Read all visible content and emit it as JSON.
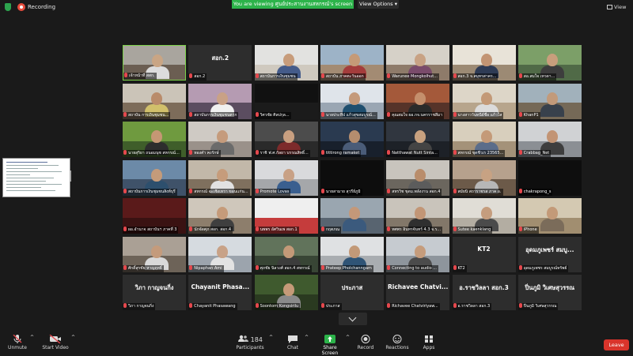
{
  "topbar": {
    "recording_label": "Recording",
    "viewing_banner": "You are viewing ศูนย์ประสานงานสหกรณ์'s screen",
    "view_options": "View Options",
    "view_button": "View"
  },
  "participants": [
    {
      "name": "เจ้าหน้าที่ สสก.",
      "big": "",
      "active": true,
      "bg": "#a9a59e",
      "bg2": "#6b5e52",
      "skin": "#c9a584",
      "shirt": "#dcdcdc"
    },
    {
      "name": "สอก.2",
      "big": "สอก.2",
      "bg": "",
      "bg2": ""
    },
    {
      "name": "สถาบันการเงินชุมชน",
      "big": "",
      "bg": "#e2e2e0",
      "bg2": "#cfc9bf",
      "skin": "#c79c7b",
      "shirt": "#445b8a"
    },
    {
      "name": "สถาบัน ภาคตะวันออก",
      "big": "",
      "bg": "#9db3c7",
      "bg2": "#a38b73",
      "skin": "#c59a77",
      "shirt": "#a43c3c"
    },
    {
      "name": "Warunee Mongkolhut...",
      "big": "",
      "bg": "#d6d1c8",
      "bg2": "#8e7b6a",
      "skin": "#c8a284",
      "shirt": "#7a4b6b"
    },
    {
      "name": "สอก.3 จ.สมุทรสาคร...",
      "big": "",
      "bg": "#e8e3d8",
      "bg2": "#9c8a74",
      "skin": "#c29473",
      "shirt": "#2e3b55"
    },
    {
      "name": "สอ.สมใจ เทวดา...",
      "big": "",
      "bg": "#7c9f68",
      "bg2": "#506a47",
      "skin": "#c89e7c",
      "shirt": "#3d3d3d"
    },
    {
      "name": "สถาบัน การเงินชุมชน...",
      "big": "",
      "bg": "#cbc4b8",
      "bg2": "#7d6c5a",
      "skin": "#b98b6a",
      "shirt": "#d1c06b"
    },
    {
      "name": "สถาบันการเงินชุมชนตาก",
      "big": "",
      "bg": "#b59bb2",
      "bg2": "#5b4d60",
      "skin": "#c9a186",
      "shirt": "#f0f0f0"
    },
    {
      "name": "วิศวชัย ศิลปกุล...",
      "big": "",
      "bg": "#111111",
      "bg2": "#1b1b1b",
      "skin": "",
      "shirt": ""
    },
    {
      "name": "นายประทีป แก้วสุขสมบูรณ์...",
      "big": "",
      "bg": "#dfe4ea",
      "bg2": "#9aa6b3",
      "skin": "#c49a7b",
      "shirt": "#1f4f6f"
    },
    {
      "name": "คุณสมใจ ผอ.กจ.นครราชสีมา",
      "big": "",
      "bg": "#a4593a",
      "bg2": "#563329",
      "skin": "#c48f6c",
      "shirt": "#2a2a2a"
    },
    {
      "name": "นางสาววันทนีย์ชื่อ แก้วใส",
      "big": "",
      "bg": "#ddd6c8",
      "bg2": "#b7a58c",
      "skin": "#c39977",
      "shirt": "#dbdbdb"
    },
    {
      "name": "KhanP1",
      "big": "",
      "bg": "#a1b1bb",
      "bg2": "#756957",
      "skin": "#c29a7a",
      "shirt": "#38414c"
    },
    {
      "name": "นายสุริยา ถนอมนุช สหกรณ์...",
      "big": "",
      "bg": "#6f9a3f",
      "bg2": "#3f5e2a",
      "skin": "#c59774",
      "shirt": "#2d2d2d"
    },
    {
      "name": "ทองคำ คงรักษ์",
      "big": "",
      "bg": "#cfcac4",
      "bg2": "#9a918a",
      "skin": "#c59b7c",
      "shirt": "#6b6b6b"
    },
    {
      "name": "ราชิ ฟ.ศ.กัลยา บรรณสิทธิ์...",
      "big": "",
      "bg": "#4c4c4c",
      "bg2": "#2a2a2a",
      "skin": "#c89f80",
      "shirt": "#7d2b2b"
    },
    {
      "name": "tittirong ramaket",
      "big": "",
      "bg": "#2a3a50",
      "bg2": "#18202c",
      "skin": "#b58d6e",
      "shirt": "#4a5c78"
    },
    {
      "name": "Natthawat Nutt Sinta...",
      "big": "",
      "bg": "#30363f",
      "bg2": "#1d2127",
      "skin": "#c8a17f",
      "shirt": "#444"
    },
    {
      "name": "สหกรณ์ ขุดชีวเร 23565...",
      "big": "",
      "bg": "#d8cfbd",
      "bg2": "#a49279",
      "skin": "#c49a78",
      "shirt": "#5b6d8a"
    },
    {
      "name": "Crabbag_Net",
      "big": "",
      "bg": "#d0d2d4",
      "bg2": "#8b8f94",
      "skin": "#c29474",
      "shirt": "#3e3e3e"
    },
    {
      "name": "สถาบันการเงินชุมชนสิงห์บุรี",
      "big": "",
      "bg": "#6c8aa8",
      "bg2": "#3f5269",
      "skin": "#c49b7a",
      "shirt": "#2d4f6d"
    },
    {
      "name": "สหกรณ์ ฉะเชิงเทรา ขอนแก่น...",
      "big": "",
      "bg": "#c2b8a9",
      "bg2": "#7f705e",
      "skin": "#c69c7b",
      "shirt": "#e2e2e2"
    },
    {
      "name": "Promote Lovas",
      "big": "",
      "bg": "#d9dadc",
      "bg2": "#a5a7aa",
      "skin": "#c8a185",
      "shirt": "#3a5f8f"
    },
    {
      "name": "นายสามาย สุวรีย์ภูมิ",
      "big": "",
      "bg": "#0d0d0d",
      "bg2": "#0d0d0d",
      "skin": "",
      "shirt": ""
    },
    {
      "name": "สหรวิช ขุดม.พลังงาน สอก.4",
      "big": "",
      "bg": "#c8c4bd",
      "bg2": "#6b665e",
      "skin": "#b98d6b",
      "shirt": "#5c5c5c"
    },
    {
      "name": "สมัยนิ สถาราชรส ภาค อ.",
      "big": "",
      "bg": "#b6a18d",
      "bg2": "#6c5a49",
      "skin": "#c7a283",
      "shirt": "#b7b7b7"
    },
    {
      "name": "chakrapong_s",
      "big": "",
      "bg": "#0e0e0e",
      "bg2": "#0e0e0e",
      "skin": "",
      "shirt": ""
    },
    {
      "name": "ผอ.อำนาจ สถาบันฯ ภาคที่ 3",
      "big": "",
      "bg": "#5a1a1a",
      "bg2": "#3a1212",
      "skin": "",
      "shirt": ""
    },
    {
      "name": "นักจัดศุภ สอก. สอก.4",
      "big": "",
      "bg": "#cfc7bb",
      "bg2": "#8d7e6c",
      "skin": "#c59b7a",
      "shirt": "#3f3f3f"
    },
    {
      "name": "นพพร อัศวินเพ สอก.1",
      "big": "",
      "bg": "#efefef",
      "bg2": "#c53c3c",
      "skin": "",
      "shirt": ""
    },
    {
      "name": "กฤตภณ",
      "big": "",
      "bg": "#9aa6b0",
      "bg2": "#586470",
      "skin": "#c49879",
      "shirt": "#3b5a7d"
    },
    {
      "name": "ทศพร อินทรจันทร์ 4.3 จ.ร...",
      "big": "",
      "bg": "#c9c4bb",
      "bg2": "#827769",
      "skin": "#c29676",
      "shirt": "#2f2f2f"
    },
    {
      "name": "Sutee kaenklang",
      "big": "",
      "bg": "#e0ddd6",
      "bg2": "#b3ada2",
      "skin": "#c59d7e",
      "shirt": "#4b4b4b"
    },
    {
      "name": "iPhone",
      "big": "",
      "bg": "#d4c9b2",
      "bg2": "#a18e70",
      "skin": "#c39a78",
      "shirt": "#7b6c5a"
    },
    {
      "name": "ศักดิ์สุรชัย หาญฤทธิ์",
      "big": "",
      "bg": "#aaa095",
      "bg2": "#6d6358",
      "skin": "#c49b7c",
      "shirt": "#d9d9d9"
    },
    {
      "name": "Nipaphan Ami",
      "big": "",
      "bg": "#d6dbe0",
      "bg2": "#9ca4ad",
      "skin": "#c8a287",
      "shirt": "#e3e3e3"
    },
    {
      "name": "ศุภชัย นิลวงศ์ สอก.4 สหกรณ์",
      "big": "",
      "bg": "#61735b",
      "bg2": "#384535",
      "skin": "#c39978",
      "shirt": "#3c3c3c"
    },
    {
      "name": "Prateep Pholchanngam",
      "big": "",
      "bg": "#dfe1e3",
      "bg2": "#a9adb1",
      "skin": "#c29978",
      "shirt": "#2f5476"
    },
    {
      "name": "Connecting to audio ...",
      "big": "",
      "bg": "#c6cbd0",
      "bg2": "#8e959c",
      "skin": "#c59c7c",
      "shirt": "#4b4b4b"
    },
    {
      "name": "KT2",
      "big": "KT2",
      "bg": "",
      "bg2": ""
    },
    {
      "name": "อุดมภูเพชร สมบูรณ์ทรัพย์",
      "big": "อุดมภูเพชร์ สมบู...",
      "bg": "",
      "bg2": ""
    },
    {
      "name": "วิภา กาญจนกิ่ง",
      "big": "วิภา กาญจนกิ่ง",
      "bg": "",
      "bg2": ""
    },
    {
      "name": "Chayanit Phasawang",
      "big": "Chayanit Phasa...",
      "bg": "",
      "bg2": ""
    },
    {
      "name": "Soontorn Kongsirilu",
      "big": "",
      "bg": "#3f5a2e",
      "bg2": "#2a3a20",
      "skin": "#c59a78",
      "shirt": "#8a8a8a"
    },
    {
      "name": "ประภาส",
      "big": "ประภาส",
      "bg": "",
      "bg2": ""
    },
    {
      "name": "Richavee Chatviriyaw...",
      "big": "Richavee Chatvi...",
      "bg": "",
      "bg2": ""
    },
    {
      "name": "อ.ราชวิลลา สอก.3",
      "big": "อ.ราชวิลลา สอก.3",
      "bg": "",
      "bg2": ""
    },
    {
      "name": "ปิ่นภูมิ วิเศษสุวรรณ",
      "big": "ปิ่นภูมิ วิเศษสุวรรณ",
      "bg": "",
      "bg2": ""
    }
  ],
  "toolbar": {
    "unmute": "Unmute",
    "start_video": "Start Video",
    "participants": "Participants",
    "participants_count": "184",
    "chat": "Chat",
    "share_screen": "Share Screen",
    "record": "Record",
    "reactions": "Reactions",
    "apps": "Apps",
    "leave": "Leave"
  },
  "colors": {
    "accent_green": "#2cb34a",
    "active_border": "#7bd148",
    "leave_red": "#d9342b",
    "muted_red": "#e5484d"
  }
}
